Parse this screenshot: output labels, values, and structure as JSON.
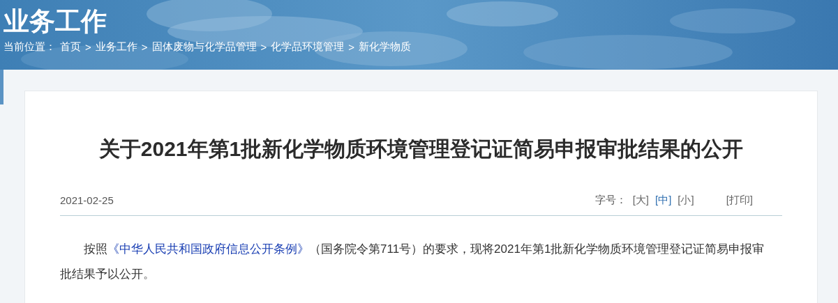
{
  "header": {
    "title": "业务工作",
    "location_label": "当前位置：",
    "separator": ">",
    "breadcrumb": [
      "首页",
      "业务工作",
      "固体废物与化学品管理",
      "化学品环境管理",
      "新化学物质"
    ]
  },
  "article": {
    "title": "关于2021年第1批新化学物质环境管理登记证简易申报审批结果的公开",
    "date": "2021-02-25",
    "font_size_label": "字号：",
    "font_sizes": [
      {
        "label": "[大]",
        "selected": false
      },
      {
        "label": "[中]",
        "selected": true
      },
      {
        "label": "[小]",
        "selected": false
      }
    ],
    "print": "[打印]",
    "paragraph": {
      "before": "按照",
      "link": "《中华人民共和国政府信息公开条例》",
      "after": "（国务院令第711号）的要求，现将2021年第1批新化学物质环境管理登记证简易申报审批结果予以公开。"
    }
  }
}
